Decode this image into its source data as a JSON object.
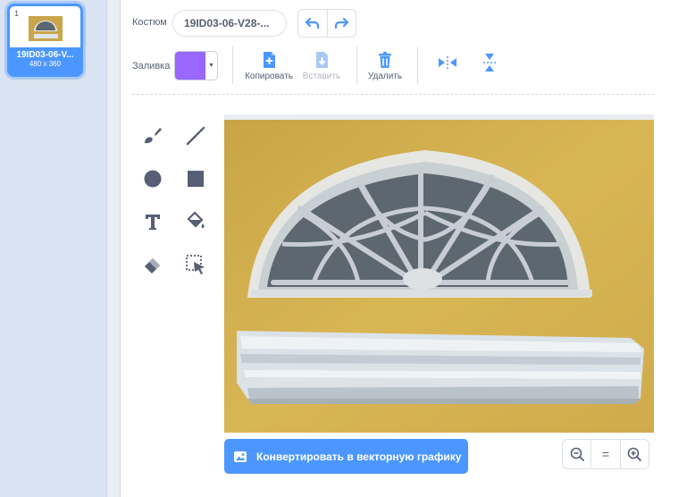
{
  "costume_list": {
    "items": [
      {
        "number": "1",
        "name": "19ID03-06-V...",
        "size": "480 x 360"
      }
    ]
  },
  "toolbar": {
    "costume_label": "Костюм",
    "costume_name": "19ID03-06-V28-...",
    "fill_label": "Заливка",
    "fill_color": "#9966ff",
    "copy_label": "Копировать",
    "paste_label": "Вставить",
    "delete_label": "Удалить"
  },
  "tools": [
    "brush-icon",
    "line-icon",
    "circle-icon",
    "rectangle-icon",
    "text-icon",
    "fill-icon",
    "eraser-icon",
    "select-icon"
  ],
  "canvas": {
    "convert_label": "Конвертировать в векторную графику",
    "zoom_out": "−",
    "zoom_reset": "=",
    "zoom_in": "+"
  },
  "colors": {
    "accent": "#4c97ff",
    "wall": "#d4ae4d",
    "sidebar": "#d9e3f2"
  }
}
